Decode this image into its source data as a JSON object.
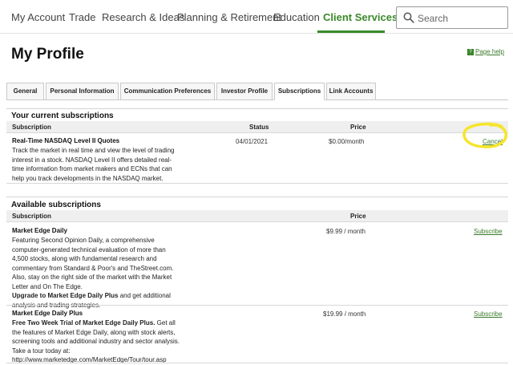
{
  "nav": {
    "items": [
      "My Account",
      "Trade",
      "Research & Ideas",
      "Planning & Retirement",
      "Education",
      "Client Services"
    ],
    "active": "Client Services",
    "search_placeholder": "Search"
  },
  "page": {
    "title": "My Profile",
    "help_label": "Page help"
  },
  "tabs": [
    "General",
    "Personal Information",
    "Communication Preferences",
    "Investor Profile",
    "Subscriptions",
    "Link Accounts"
  ],
  "active_tab": "Subscriptions",
  "current": {
    "title": "Your current subscriptions",
    "columns": {
      "subscription": "Subscription",
      "status": "Status",
      "price": "Price"
    },
    "rows": [
      {
        "name": "Real-Time NASDAQ Level II Quotes",
        "desc_lines": [
          "Track the market in real time and view the level of trading",
          "interest in a stock. NASDAQ Level II offers detailed real-",
          "time information from market makers and ECNs that can",
          "help you track developments in the NASDAQ market."
        ],
        "status": "04/01/2021",
        "price": "$0.00/month",
        "action": "Cancel"
      }
    ]
  },
  "available": {
    "title": "Available subscriptions",
    "columns": {
      "subscription": "Subscription",
      "price": "Price"
    },
    "rows": [
      {
        "name": "Market Edge Daily",
        "desc_lines": [
          "Featuring Second Opinion Daily, a comprehensive",
          "computer-generated technical evaluation of more than",
          "4,500 stocks, along with fundamental research and",
          "commentary from Standard & Poor's and TheStreet.com.",
          "Also, stay on the right side of the market with the Market",
          "Letter and On The Edge."
        ],
        "upgrade_bold": "Upgrade to Market Edge Daily Plus",
        "upgrade_rest": " and get additional",
        "upgrade_line2": "analysis and trading strategies.",
        "price": "$9.99 / month",
        "action": "Subscribe"
      },
      {
        "name": "Market Edge Daily Plus",
        "trial_bold": "Free Two Week Trial of Market Edge Daily Plus.",
        "trial_rest": " Get all",
        "desc_lines": [
          "the features of Market Edge Daily, along with stock alerts,",
          "screening tools and additional industry and sector analysis.",
          "Take a tour today at:"
        ],
        "url": "http://www.marketedge.com/MarketEdge/Tour/tour.asp",
        "price": "$19.99 / month",
        "action": "Subscribe"
      }
    ]
  },
  "colors": {
    "accent": "#3a8a2a",
    "highlight": "#f5e52a"
  }
}
